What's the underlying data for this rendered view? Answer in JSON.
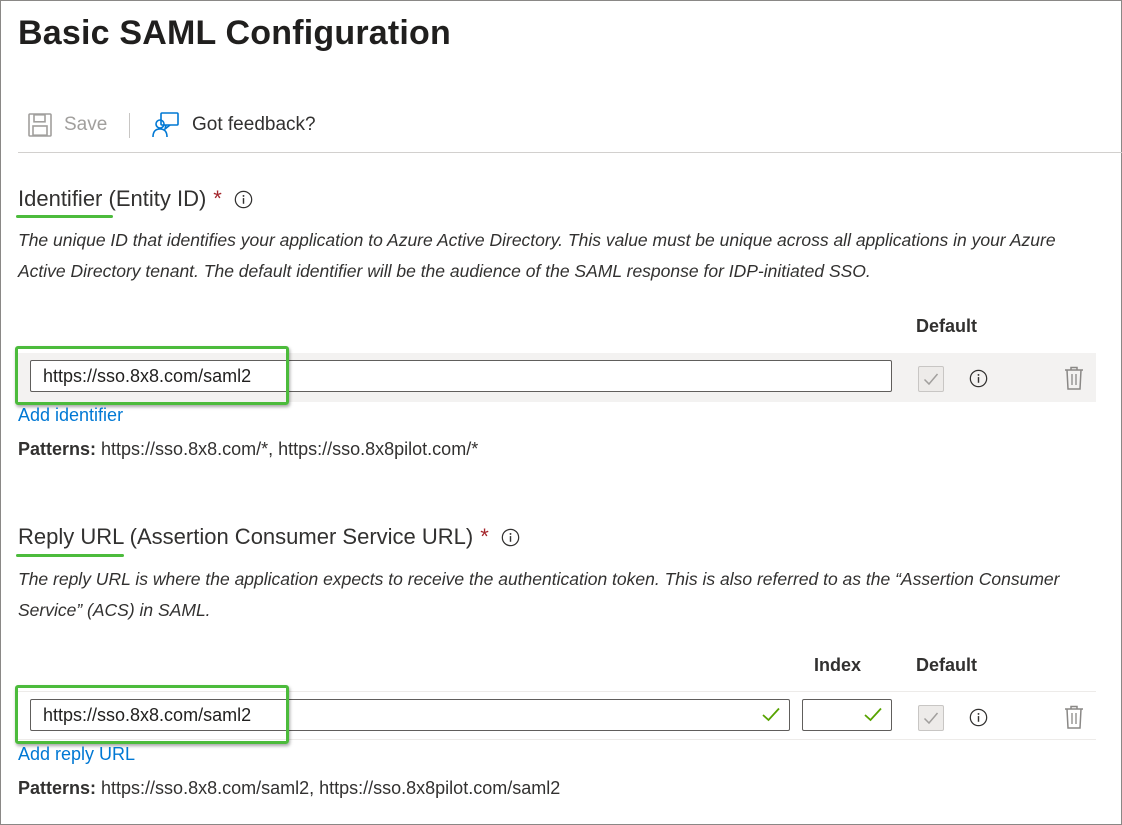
{
  "page": {
    "title": "Basic SAML Configuration"
  },
  "toolbar": {
    "save_label": "Save",
    "feedback_label": "Got feedback?",
    "save_icon": "save-icon",
    "feedback_icon": "feedback-icon"
  },
  "identifier": {
    "heading": "Identifier (Entity ID)",
    "required_mark": "*",
    "description": "The unique ID that identifies your application to Azure Active Directory. This value must be unique across all applications in your Azure Active Directory tenant. The default identifier will be the audience of the SAML response for IDP-initiated SSO.",
    "default_column": "Default",
    "value": "https://sso.8x8.com/saml2",
    "add_link": "Add identifier",
    "patterns_label": "Patterns:",
    "patterns_value": " https://sso.8x8.com/*, https://sso.8x8pilot.com/*"
  },
  "reply_url": {
    "heading": "Reply URL (Assertion Consumer Service URL)",
    "required_mark": "*",
    "description": "The reply URL is where the application expects to receive the authentication token. This is also referred to as the “Assertion Consumer Service” (ACS) in SAML.",
    "index_column": "Index",
    "default_column": "Default",
    "value": "https://sso.8x8.com/saml2",
    "index_value": "",
    "add_link": "Add reply URL",
    "patterns_label": "Patterns:",
    "patterns_value": " https://sso.8x8.com/saml2, https://sso.8x8pilot.com/saml2"
  },
  "colors": {
    "accent": "#0078d4",
    "required": "#a4262c",
    "highlight": "#4cbb3c",
    "valid": "#57a300"
  }
}
